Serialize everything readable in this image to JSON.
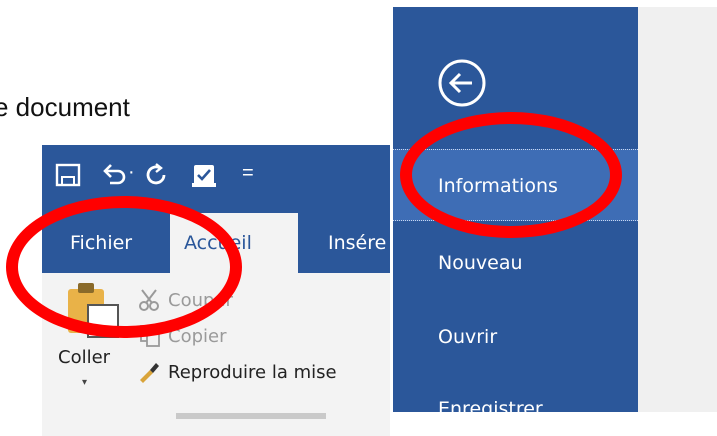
{
  "document_text": "e document",
  "ribbon": {
    "quick_access": {
      "icons": [
        "save-icon",
        "undo-icon",
        "redo-icon",
        "touch-mode-icon",
        "customize-icon"
      ],
      "undo_dropdown": "·",
      "customize": "="
    },
    "tabs": [
      {
        "label": "Fichier",
        "active": false
      },
      {
        "label": "Accueil",
        "active": true
      },
      {
        "label": "Insére",
        "active": false
      }
    ],
    "clipboard": {
      "paste_label": "Coller",
      "paste_dropdown": "▾",
      "commands": [
        {
          "label": "Couper",
          "icon": "scissors-icon",
          "enabled": false
        },
        {
          "label": "Copier",
          "icon": "copy-icon",
          "enabled": false
        },
        {
          "label": "Reproduire la mise",
          "icon": "format-painter-icon",
          "enabled": true
        }
      ]
    }
  },
  "backstage": {
    "back_icon": "back-arrow-icon",
    "items": [
      {
        "label": "Informations",
        "selected": true
      },
      {
        "label": "Nouveau",
        "selected": false
      },
      {
        "label": "Ouvrir",
        "selected": false
      },
      {
        "label": "Enregistrer",
        "selected": false
      }
    ]
  },
  "colors": {
    "word_blue": "#2b579a",
    "selected_item": "#3e6db5",
    "ribbon_bg": "#f3f3f3",
    "annotation_red": "#ff0000"
  }
}
